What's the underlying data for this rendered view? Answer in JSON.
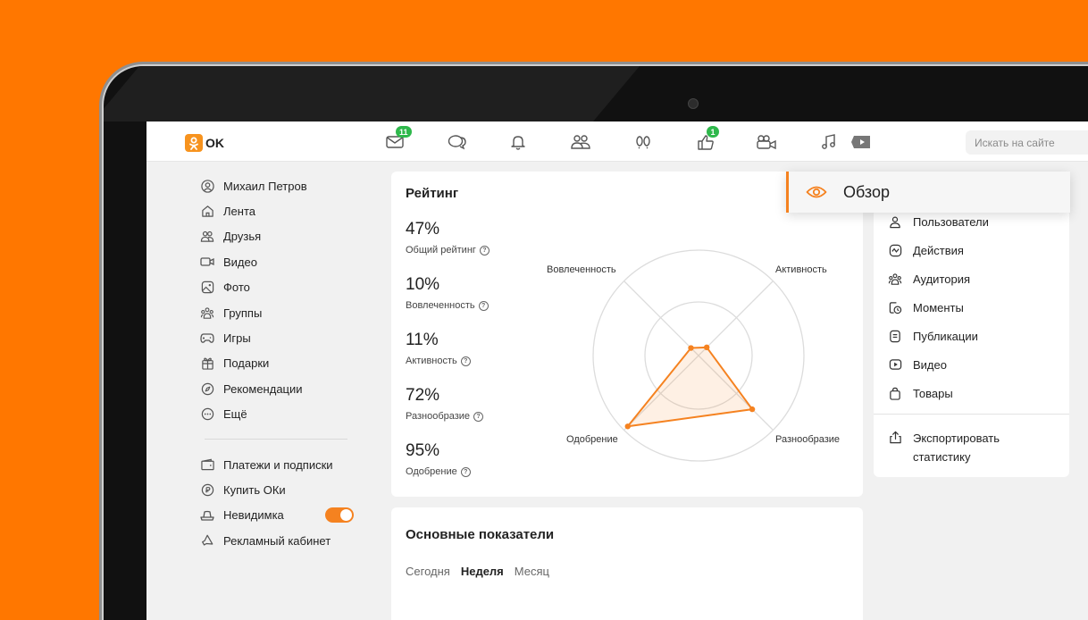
{
  "app": {
    "logo_text": "OK"
  },
  "topbar": {
    "messages_badge": "11",
    "likes_badge": "1",
    "search_placeholder": "Искать на сайте",
    "icons": [
      "mail-icon",
      "chat-icon",
      "bell-icon",
      "friends-icon",
      "footprints-icon",
      "like-icon",
      "video-camera-icon",
      "music-icon",
      "video-tab-icon"
    ]
  },
  "sidebar": {
    "items": [
      {
        "label": "Михаил Петров",
        "icon": "user-icon"
      },
      {
        "label": "Лента",
        "icon": "home-icon"
      },
      {
        "label": "Друзья",
        "icon": "friends-icon"
      },
      {
        "label": "Видео",
        "icon": "video-icon"
      },
      {
        "label": "Фото",
        "icon": "photo-icon"
      },
      {
        "label": "Группы",
        "icon": "groups-icon"
      },
      {
        "label": "Игры",
        "icon": "gamepad-icon"
      },
      {
        "label": "Подарки",
        "icon": "gift-icon"
      },
      {
        "label": "Рекомендации",
        "icon": "compass-icon"
      },
      {
        "label": "Ещё",
        "icon": "more-icon"
      }
    ],
    "bottom_items": [
      {
        "label": "Платежи и подписки",
        "icon": "wallet-icon"
      },
      {
        "label": "Купить ОКи",
        "icon": "coin-icon"
      },
      {
        "label": "Невидимка",
        "icon": "hat-icon",
        "toggle_on": true
      },
      {
        "label": "Рекламный кабинет",
        "icon": "megaphone-icon"
      }
    ]
  },
  "rating": {
    "title": "Рейтинг",
    "metrics": [
      {
        "value": "47%",
        "label": "Общий рейтинг"
      },
      {
        "value": "10%",
        "label": "Вовлеченность"
      },
      {
        "value": "11%",
        "label": "Активность"
      },
      {
        "value": "72%",
        "label": "Разнообразие"
      },
      {
        "value": "95%",
        "label": "Одобрение"
      }
    ],
    "radar_labels": {
      "top_left": "Вовлеченность",
      "top_right": "Активность",
      "bottom_right": "Разнообразие",
      "bottom_left": "Одобрение"
    }
  },
  "chart_data": {
    "type": "radar",
    "axes": [
      "Вовлеченность",
      "Активность",
      "Разнообразие",
      "Одобрение"
    ],
    "values": [
      10,
      11,
      72,
      95
    ],
    "range": [
      0,
      100
    ],
    "grid": true,
    "color": "#f58220"
  },
  "main_indicators": {
    "title": "Основные показатели",
    "tabs": [
      "Сегодня",
      "Неделя",
      "Месяц"
    ],
    "active_tab": 1
  },
  "overview": {
    "label": "Обзор",
    "icon": "eye-icon",
    "accent": "#f58220"
  },
  "right_panel": {
    "items": [
      {
        "label": "Пользователи",
        "icon": "user-icon"
      },
      {
        "label": "Действия",
        "icon": "activity-icon"
      },
      {
        "label": "Аудитория",
        "icon": "audience-icon"
      },
      {
        "label": "Моменты",
        "icon": "moments-icon"
      },
      {
        "label": "Публикации",
        "icon": "publications-icon"
      },
      {
        "label": "Видео",
        "icon": "play-icon"
      },
      {
        "label": "Товары",
        "icon": "bag-icon"
      }
    ],
    "export_line1": "Экспортировать",
    "export_line2": "статистику"
  }
}
